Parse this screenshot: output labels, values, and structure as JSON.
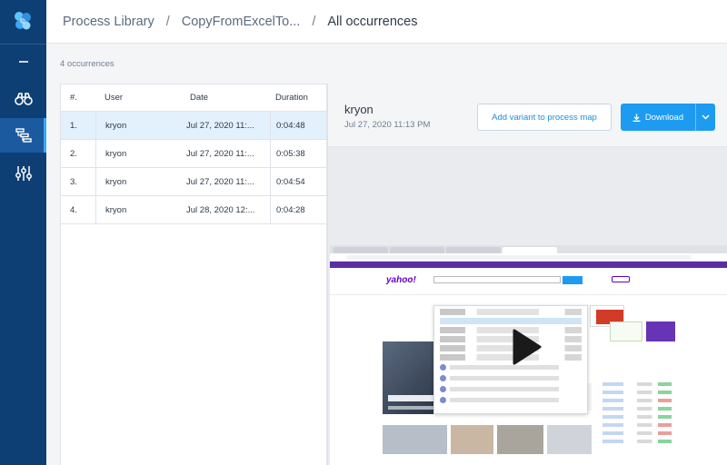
{
  "sidebar": {
    "logo_icon": "kryon-logo-icon",
    "items": [
      {
        "name": "collapse",
        "icon": "minus-icon"
      },
      {
        "name": "discovery",
        "icon": "binoculars-icon"
      },
      {
        "name": "process-library",
        "icon": "process-tree-icon",
        "active": true
      },
      {
        "name": "settings",
        "icon": "sliders-icon"
      }
    ]
  },
  "breadcrumb": {
    "root": "Process Library",
    "process": "CopyFromExcelTo...",
    "current": "All occurrences",
    "separator": "/"
  },
  "occurrence_count": "4 occurrences",
  "table": {
    "headers": {
      "num": "#.",
      "user": "User",
      "date": "Date",
      "duration": "Duration"
    },
    "rows": [
      {
        "num": "1.",
        "user": "kryon",
        "date": "Jul 27, 2020 11:...",
        "duration": "0:04:48",
        "selected": true
      },
      {
        "num": "2.",
        "user": "kryon",
        "date": "Jul 27, 2020 11:...",
        "duration": "0:05:38"
      },
      {
        "num": "3.",
        "user": "kryon",
        "date": "Jul 27, 2020 11:...",
        "duration": "0:04:54"
      },
      {
        "num": "4.",
        "user": "kryon",
        "date": "Jul 28, 2020 12:...",
        "duration": "0:04:28"
      }
    ]
  },
  "detail": {
    "user": "kryon",
    "date": "Jul 27, 2020 11:13 PM",
    "add_variant_label": "Add variant to process map",
    "download_label": "Download"
  },
  "video": {
    "brand": "yahoo!"
  },
  "colors": {
    "sidebar": "#0e3f74",
    "accent": "#1d9bf0",
    "selected_row": "#e3f1fc"
  }
}
